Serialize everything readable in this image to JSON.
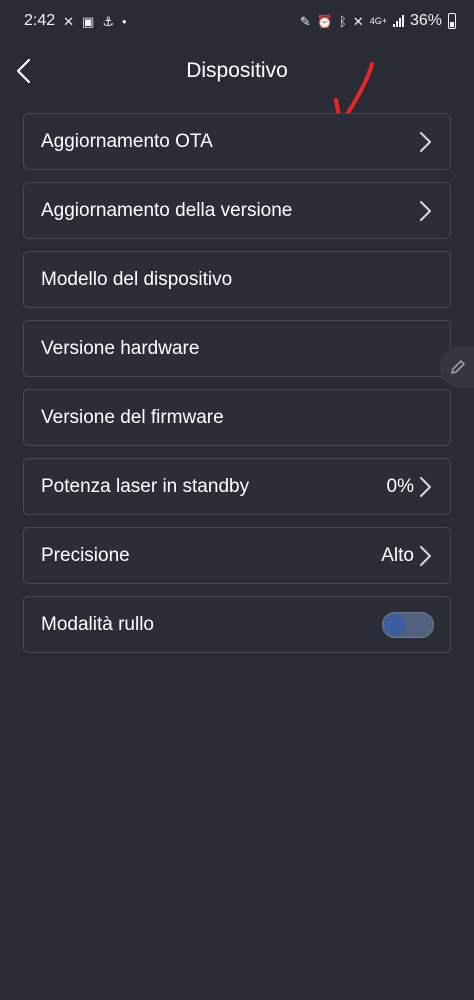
{
  "status_bar": {
    "time": "2:42",
    "network": "4G+",
    "battery": "36%",
    "left_icons": [
      "tools-icon",
      "gallery-icon",
      "app-icon",
      "dot-icon"
    ],
    "right_icons": [
      "edit-icon",
      "alarm-icon",
      "bluetooth-icon",
      "mute-icon",
      "signal-icon",
      "battery-icon"
    ]
  },
  "header": {
    "title": "Dispositivo"
  },
  "settings": {
    "items": [
      {
        "label": "Aggiornamento OTA"
      },
      {
        "label": "Aggiornamento della versione"
      },
      {
        "label": "Modello del dispositivo"
      },
      {
        "label": "Versione hardware"
      },
      {
        "label": "Versione del firmware"
      },
      {
        "label": "Potenza laser in standby",
        "value": "0%"
      },
      {
        "label": "Precisione",
        "value": "Alto"
      },
      {
        "label": "Modalità rullo",
        "toggle_on": false
      }
    ]
  },
  "colors": {
    "background": "#292c35",
    "row_border": "#474a53",
    "annotation": "#e8262a",
    "toggle_track": "#52627e",
    "toggle_knob": "#3a5ea0"
  }
}
